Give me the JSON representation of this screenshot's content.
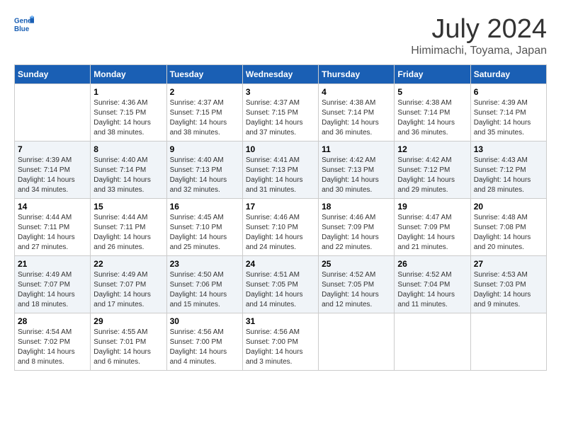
{
  "header": {
    "logo_line1": "General",
    "logo_line2": "Blue",
    "month_title": "July 2024",
    "subtitle": "Himimachi, Toyama, Japan"
  },
  "weekdays": [
    "Sunday",
    "Monday",
    "Tuesday",
    "Wednesday",
    "Thursday",
    "Friday",
    "Saturday"
  ],
  "weeks": [
    [
      {
        "day": "",
        "info": ""
      },
      {
        "day": "1",
        "info": "Sunrise: 4:36 AM\nSunset: 7:15 PM\nDaylight: 14 hours\nand 38 minutes."
      },
      {
        "day": "2",
        "info": "Sunrise: 4:37 AM\nSunset: 7:15 PM\nDaylight: 14 hours\nand 38 minutes."
      },
      {
        "day": "3",
        "info": "Sunrise: 4:37 AM\nSunset: 7:15 PM\nDaylight: 14 hours\nand 37 minutes."
      },
      {
        "day": "4",
        "info": "Sunrise: 4:38 AM\nSunset: 7:14 PM\nDaylight: 14 hours\nand 36 minutes."
      },
      {
        "day": "5",
        "info": "Sunrise: 4:38 AM\nSunset: 7:14 PM\nDaylight: 14 hours\nand 36 minutes."
      },
      {
        "day": "6",
        "info": "Sunrise: 4:39 AM\nSunset: 7:14 PM\nDaylight: 14 hours\nand 35 minutes."
      }
    ],
    [
      {
        "day": "7",
        "info": "Sunrise: 4:39 AM\nSunset: 7:14 PM\nDaylight: 14 hours\nand 34 minutes."
      },
      {
        "day": "8",
        "info": "Sunrise: 4:40 AM\nSunset: 7:14 PM\nDaylight: 14 hours\nand 33 minutes."
      },
      {
        "day": "9",
        "info": "Sunrise: 4:40 AM\nSunset: 7:13 PM\nDaylight: 14 hours\nand 32 minutes."
      },
      {
        "day": "10",
        "info": "Sunrise: 4:41 AM\nSunset: 7:13 PM\nDaylight: 14 hours\nand 31 minutes."
      },
      {
        "day": "11",
        "info": "Sunrise: 4:42 AM\nSunset: 7:13 PM\nDaylight: 14 hours\nand 30 minutes."
      },
      {
        "day": "12",
        "info": "Sunrise: 4:42 AM\nSunset: 7:12 PM\nDaylight: 14 hours\nand 29 minutes."
      },
      {
        "day": "13",
        "info": "Sunrise: 4:43 AM\nSunset: 7:12 PM\nDaylight: 14 hours\nand 28 minutes."
      }
    ],
    [
      {
        "day": "14",
        "info": "Sunrise: 4:44 AM\nSunset: 7:11 PM\nDaylight: 14 hours\nand 27 minutes."
      },
      {
        "day": "15",
        "info": "Sunrise: 4:44 AM\nSunset: 7:11 PM\nDaylight: 14 hours\nand 26 minutes."
      },
      {
        "day": "16",
        "info": "Sunrise: 4:45 AM\nSunset: 7:10 PM\nDaylight: 14 hours\nand 25 minutes."
      },
      {
        "day": "17",
        "info": "Sunrise: 4:46 AM\nSunset: 7:10 PM\nDaylight: 14 hours\nand 24 minutes."
      },
      {
        "day": "18",
        "info": "Sunrise: 4:46 AM\nSunset: 7:09 PM\nDaylight: 14 hours\nand 22 minutes."
      },
      {
        "day": "19",
        "info": "Sunrise: 4:47 AM\nSunset: 7:09 PM\nDaylight: 14 hours\nand 21 minutes."
      },
      {
        "day": "20",
        "info": "Sunrise: 4:48 AM\nSunset: 7:08 PM\nDaylight: 14 hours\nand 20 minutes."
      }
    ],
    [
      {
        "day": "21",
        "info": "Sunrise: 4:49 AM\nSunset: 7:07 PM\nDaylight: 14 hours\nand 18 minutes."
      },
      {
        "day": "22",
        "info": "Sunrise: 4:49 AM\nSunset: 7:07 PM\nDaylight: 14 hours\nand 17 minutes."
      },
      {
        "day": "23",
        "info": "Sunrise: 4:50 AM\nSunset: 7:06 PM\nDaylight: 14 hours\nand 15 minutes."
      },
      {
        "day": "24",
        "info": "Sunrise: 4:51 AM\nSunset: 7:05 PM\nDaylight: 14 hours\nand 14 minutes."
      },
      {
        "day": "25",
        "info": "Sunrise: 4:52 AM\nSunset: 7:05 PM\nDaylight: 14 hours\nand 12 minutes."
      },
      {
        "day": "26",
        "info": "Sunrise: 4:52 AM\nSunset: 7:04 PM\nDaylight: 14 hours\nand 11 minutes."
      },
      {
        "day": "27",
        "info": "Sunrise: 4:53 AM\nSunset: 7:03 PM\nDaylight: 14 hours\nand 9 minutes."
      }
    ],
    [
      {
        "day": "28",
        "info": "Sunrise: 4:54 AM\nSunset: 7:02 PM\nDaylight: 14 hours\nand 8 minutes."
      },
      {
        "day": "29",
        "info": "Sunrise: 4:55 AM\nSunset: 7:01 PM\nDaylight: 14 hours\nand 6 minutes."
      },
      {
        "day": "30",
        "info": "Sunrise: 4:56 AM\nSunset: 7:00 PM\nDaylight: 14 hours\nand 4 minutes."
      },
      {
        "day": "31",
        "info": "Sunrise: 4:56 AM\nSunset: 7:00 PM\nDaylight: 14 hours\nand 3 minutes."
      },
      {
        "day": "",
        "info": ""
      },
      {
        "day": "",
        "info": ""
      },
      {
        "day": "",
        "info": ""
      }
    ]
  ]
}
